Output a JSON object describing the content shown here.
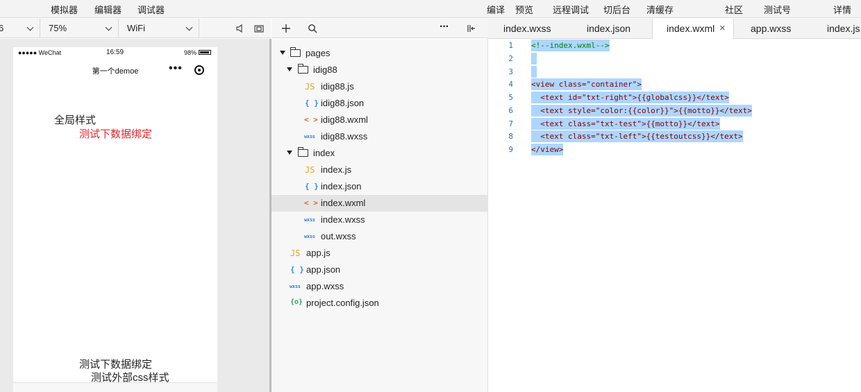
{
  "menubar": {
    "items": [
      "模拟器",
      "编辑器",
      "调试器"
    ],
    "right_items": [
      "编译",
      "预览",
      "远程调试",
      "切后台",
      "清缓存"
    ],
    "far_right": [
      "社区",
      "测试号",
      "详情"
    ]
  },
  "simulator_toolbar": {
    "device_partial": "6",
    "zoom": "75%",
    "network": "WiFi"
  },
  "phone": {
    "carrier": "●●●●● WeChat",
    "time": "16:59",
    "battery": "98%",
    "nav_title": "第一个demoe",
    "nav_more": "•••",
    "texts": {
      "global_style": "全局样式",
      "bind_red": "测试下数据绑定",
      "bind_black": "测试下数据绑定",
      "outer_css": "测试外部css样式"
    },
    "red_color": "#e8252b"
  },
  "explorer": {
    "tree": [
      {
        "name": "pages",
        "kind": "folder"
      },
      {
        "name": "idig88",
        "kind": "folder"
      },
      {
        "name": "idig88.js",
        "kind": "js",
        "icon": "JS"
      },
      {
        "name": "idig88.json",
        "kind": "json",
        "icon": "{ }"
      },
      {
        "name": "idig88.wxml",
        "kind": "wxml",
        "icon": "< >"
      },
      {
        "name": "idig88.wxss",
        "kind": "wxss",
        "icon": "wxss"
      },
      {
        "name": "index",
        "kind": "folder"
      },
      {
        "name": "index.js",
        "kind": "js",
        "icon": "JS"
      },
      {
        "name": "index.json",
        "kind": "json",
        "icon": "{ }"
      },
      {
        "name": "index.wxml",
        "kind": "wxml",
        "icon": "< >",
        "active": true
      },
      {
        "name": "index.wxss",
        "kind": "wxss",
        "icon": "wxss"
      },
      {
        "name": "out.wxss",
        "kind": "wxss",
        "icon": "wxss"
      },
      {
        "name": "app.js",
        "kind": "js",
        "icon": "JS"
      },
      {
        "name": "app.json",
        "kind": "json",
        "icon": "{ }"
      },
      {
        "name": "app.wxss",
        "kind": "wxss",
        "icon": "wxss"
      },
      {
        "name": "project.config.json",
        "kind": "cfg",
        "icon": "{o}"
      }
    ],
    "more": "···"
  },
  "editor": {
    "tabs": [
      {
        "label": "index.wxss"
      },
      {
        "label": "index.json"
      },
      {
        "label": "index.wxml",
        "active": true
      },
      {
        "label": "app.wxss"
      },
      {
        "label": "index.js"
      }
    ],
    "close_glyph": "×",
    "line_numbers": [
      "1",
      "2",
      "3",
      "4",
      "5",
      "6",
      "7",
      "8",
      "9"
    ],
    "lines": [
      "<!--index.wxml-->",
      "",
      "",
      "<view class=\"container\">",
      "  <text id=\"txt-right\">{{globalcss}}</text>",
      "  <text style=\"color:{{color}}\">{{motto}}</text>",
      "  <text class=\"txt-test\">{{motto}}</text>",
      "  <text class=\"txt-left\">{{testoutcss}}</text>",
      "</view>"
    ]
  }
}
